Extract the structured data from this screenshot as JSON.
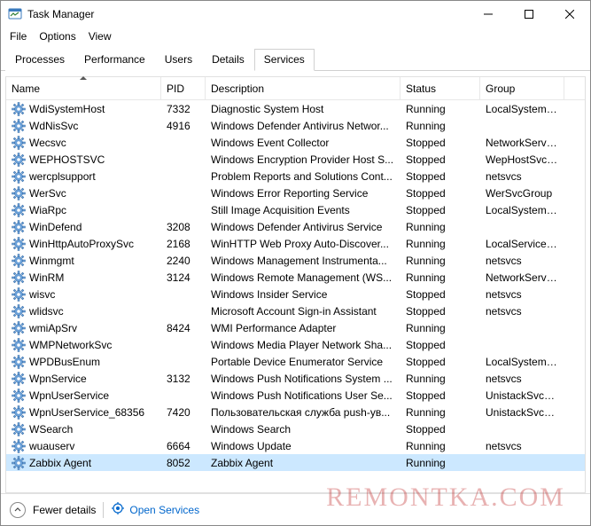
{
  "window": {
    "title": "Task Manager"
  },
  "menu": {
    "file": "File",
    "options": "Options",
    "view": "View"
  },
  "tabs": {
    "processes": "Processes",
    "performance": "Performance",
    "users": "Users",
    "details": "Details",
    "services": "Services"
  },
  "columns": {
    "name": "Name",
    "pid": "PID",
    "description": "Description",
    "status": "Status",
    "group": "Group"
  },
  "services": [
    {
      "name": "WdiSystemHost",
      "pid": "7332",
      "desc": "Diagnostic System Host",
      "status": "Running",
      "group": "LocalSystemN..."
    },
    {
      "name": "WdNisSvc",
      "pid": "4916",
      "desc": "Windows Defender Antivirus Networ...",
      "status": "Running",
      "group": ""
    },
    {
      "name": "Wecsvc",
      "pid": "",
      "desc": "Windows Event Collector",
      "status": "Stopped",
      "group": "NetworkService"
    },
    {
      "name": "WEPHOSTSVC",
      "pid": "",
      "desc": "Windows Encryption Provider Host S...",
      "status": "Stopped",
      "group": "WepHostSvcG..."
    },
    {
      "name": "wercplsupport",
      "pid": "",
      "desc": "Problem Reports and Solutions Cont...",
      "status": "Stopped",
      "group": "netsvcs"
    },
    {
      "name": "WerSvc",
      "pid": "",
      "desc": "Windows Error Reporting Service",
      "status": "Stopped",
      "group": "WerSvcGroup"
    },
    {
      "name": "WiaRpc",
      "pid": "",
      "desc": "Still Image Acquisition Events",
      "status": "Stopped",
      "group": "LocalSystemN..."
    },
    {
      "name": "WinDefend",
      "pid": "3208",
      "desc": "Windows Defender Antivirus Service",
      "status": "Running",
      "group": ""
    },
    {
      "name": "WinHttpAutoProxySvc",
      "pid": "2168",
      "desc": "WinHTTP Web Proxy Auto-Discover...",
      "status": "Running",
      "group": "LocalServiceN..."
    },
    {
      "name": "Winmgmt",
      "pid": "2240",
      "desc": "Windows Management Instrumenta...",
      "status": "Running",
      "group": "netsvcs"
    },
    {
      "name": "WinRM",
      "pid": "3124",
      "desc": "Windows Remote Management (WS...",
      "status": "Running",
      "group": "NetworkService"
    },
    {
      "name": "wisvc",
      "pid": "",
      "desc": "Windows Insider Service",
      "status": "Stopped",
      "group": "netsvcs"
    },
    {
      "name": "wlidsvc",
      "pid": "",
      "desc": "Microsoft Account Sign-in Assistant",
      "status": "Stopped",
      "group": "netsvcs"
    },
    {
      "name": "wmiApSrv",
      "pid": "8424",
      "desc": "WMI Performance Adapter",
      "status": "Running",
      "group": ""
    },
    {
      "name": "WMPNetworkSvc",
      "pid": "",
      "desc": "Windows Media Player Network Sha...",
      "status": "Stopped",
      "group": ""
    },
    {
      "name": "WPDBusEnum",
      "pid": "",
      "desc": "Portable Device Enumerator Service",
      "status": "Stopped",
      "group": "LocalSystemN..."
    },
    {
      "name": "WpnService",
      "pid": "3132",
      "desc": "Windows Push Notifications System ...",
      "status": "Running",
      "group": "netsvcs"
    },
    {
      "name": "WpnUserService",
      "pid": "",
      "desc": "Windows Push Notifications User Se...",
      "status": "Stopped",
      "group": "UnistackSvcGr..."
    },
    {
      "name": "WpnUserService_68356",
      "pid": "7420",
      "desc": "Пользовательская служба push-ув...",
      "status": "Running",
      "group": "UnistackSvcGr..."
    },
    {
      "name": "WSearch",
      "pid": "",
      "desc": "Windows Search",
      "status": "Stopped",
      "group": ""
    },
    {
      "name": "wuauserv",
      "pid": "6664",
      "desc": "Windows Update",
      "status": "Running",
      "group": "netsvcs"
    },
    {
      "name": "Zabbix Agent",
      "pid": "8052",
      "desc": "Zabbix Agent",
      "status": "Running",
      "group": "",
      "selected": true
    }
  ],
  "footer": {
    "fewer": "Fewer details",
    "open_services": "Open Services"
  },
  "watermark": "REMONTKA.COM"
}
